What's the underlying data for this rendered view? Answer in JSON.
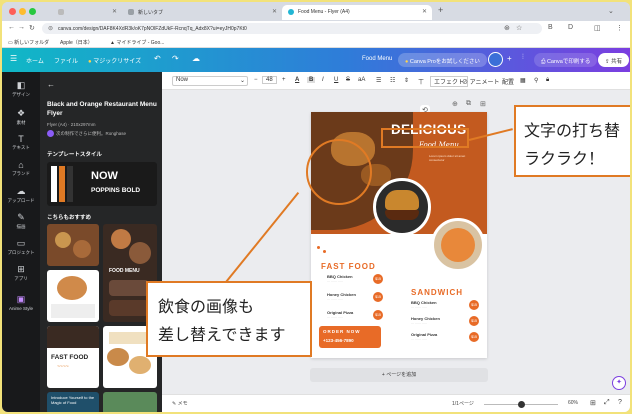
{
  "browser": {
    "tabs": [
      {
        "label": "",
        "active": false
      },
      {
        "label": "新しいタブ",
        "active": false
      },
      {
        "label": "Food Menu - Flyer (A4)",
        "active": true
      }
    ],
    "url": "canva.com/design/DAF8K4XdR3k/oK7pNOlFZdUkF-RcnqTq_Adx8X?ui=eyJH0p7Kt0",
    "bookmarks": [
      "新しいフォルダ",
      "Apple（日本）",
      "マイドライブ - Goo..."
    ]
  },
  "canva_toolbar": {
    "home": "ホーム",
    "file": "ファイル",
    "magic": "マジックリサイズ",
    "doc_title": "Food Menu",
    "pro_trial": "Canva Proをお試しください",
    "print": "Canvaで印刷する",
    "share": "共有"
  },
  "rail": [
    {
      "label": "デザイン",
      "icon": "layout-icon"
    },
    {
      "label": "素材",
      "icon": "shapes-icon"
    },
    {
      "label": "テキスト",
      "icon": "text-icon"
    },
    {
      "label": "ブランド",
      "icon": "brand-icon"
    },
    {
      "label": "アップロード",
      "icon": "cloud-icon"
    },
    {
      "label": "描画",
      "icon": "pen-icon"
    },
    {
      "label": "プロジェクト",
      "icon": "folder-icon"
    },
    {
      "label": "アプリ",
      "icon": "apps-icon"
    },
    {
      "label": "Anime Style",
      "icon": "anime-icon"
    }
  ],
  "panel": {
    "template_title": "Black and Orange Restaurant Menu Flyer",
    "template_size": "Flyer (A4) · 210x297mm",
    "owner": "次の制作でさらに便利。Ronghase",
    "section_text_style": "テンプレートスタイル",
    "style_sample_1": "NOW",
    "style_sample_2": "POPPINS BOLD",
    "section_recommended": "こちらもおすすめ",
    "thumb_food_menu": "FOOD MENU",
    "thumb_fast_food": "FAST FOOD",
    "thumb_bottom": "Introduce Yourself to the Magic of Food"
  },
  "format_toolbar": {
    "font": "Now",
    "size": "48",
    "effects": "エフェクト",
    "animate": "アニメート",
    "position": "配置"
  },
  "flyer": {
    "headline": "DELICIOUS",
    "script": "Food Menu",
    "fast_food": "FAST FOOD",
    "sandwich": "SANDWICH",
    "items_left": [
      "BBQ Chicken",
      "Honey Chicken",
      "Original Pizza"
    ],
    "items_right": [
      "BBQ Chicken",
      "Honey Chicken",
      "Original Pizza"
    ],
    "prices": [
      "$15",
      "$15",
      "$15"
    ],
    "order_now": "ORDER NOW",
    "phone": "+123-456-7890"
  },
  "canvas": {
    "add_page": "+ ページを追加",
    "notes": "メモ",
    "page_indicator": "1/1ページ",
    "zoom": "60%"
  },
  "callouts": {
    "top_right_line1": "文字の打ち替",
    "top_right_line2": "ラクラク！",
    "bottom_left_line1": "飲食の画像も",
    "bottom_left_line2": "差し替えできます"
  },
  "colors": {
    "accent": "#e07a24",
    "flyer_orange": "#c35a1f",
    "toolbar_start": "#10b8c6",
    "toolbar_end": "#7b3ee0"
  }
}
